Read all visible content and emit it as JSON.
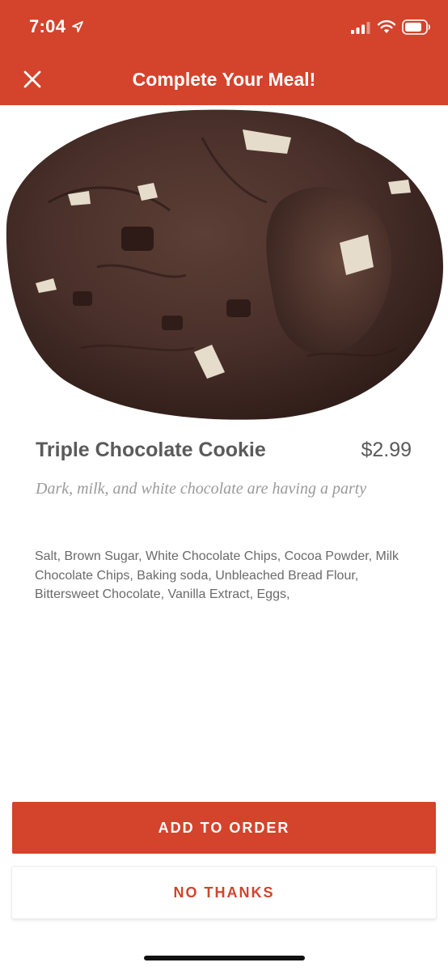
{
  "status_bar": {
    "time": "7:04"
  },
  "nav": {
    "title": "Complete Your Meal!",
    "close_icon": "close-icon"
  },
  "product": {
    "name": "Triple Chocolate Cookie",
    "price": "$2.99",
    "tagline": "Dark, milk, and white chocolate are having a party",
    "ingredients": "Salt, Brown Sugar, White Chocolate Chips, Cocoa Powder, Milk Chocolate Chips, Baking soda, Unbleached Bread Flour, Bittersweet Chocolate, Vanilla Extract, Eggs,"
  },
  "actions": {
    "add_label": "ADD TO ORDER",
    "decline_label": "NO THANKS"
  },
  "colors": {
    "brand": "#d4432c",
    "text_dark": "#5a5a5a",
    "text_muted": "#9a9a9a",
    "text_body": "#6a6a6a"
  }
}
